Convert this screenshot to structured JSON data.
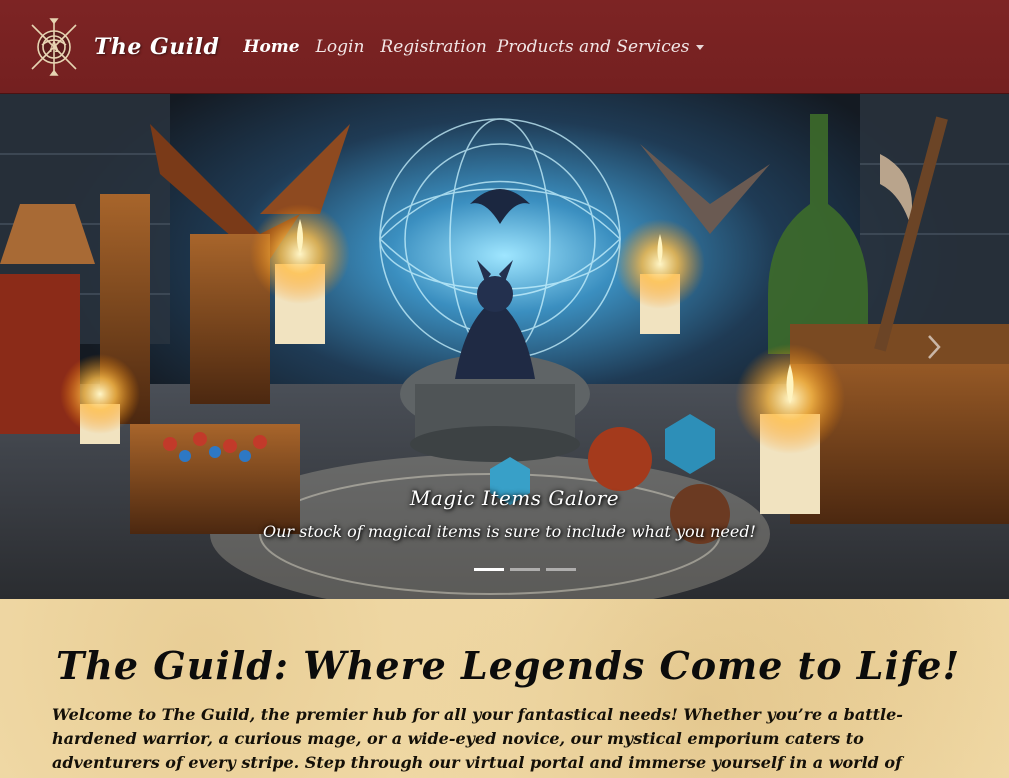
{
  "navbar": {
    "brand": "The Guild",
    "links": [
      {
        "label": "Home",
        "active": true
      },
      {
        "label": "Login",
        "active": false
      },
      {
        "label": "Registration",
        "active": false
      },
      {
        "label": "Products and Services",
        "active": false,
        "dropdown": true
      }
    ],
    "background_color": "#7d2424"
  },
  "carousel": {
    "slide_title": "Magic Items Galore",
    "slide_text": "Our stock of magical items is sure to include what you need!",
    "indicator_count": 3,
    "active_indicator": 0
  },
  "main": {
    "title": "The Guild: Where Legends Come to Life!",
    "intro": "Welcome to The Guild, the premier hub for all your fantastical needs! Whether you’re a battle-hardened warrior, a curious mage, or a wide-eyed novice, our mystical emporium caters to adventurers of every stripe. Step through our virtual portal and immerse yourself in a world of wonder, danger, and untold"
  }
}
